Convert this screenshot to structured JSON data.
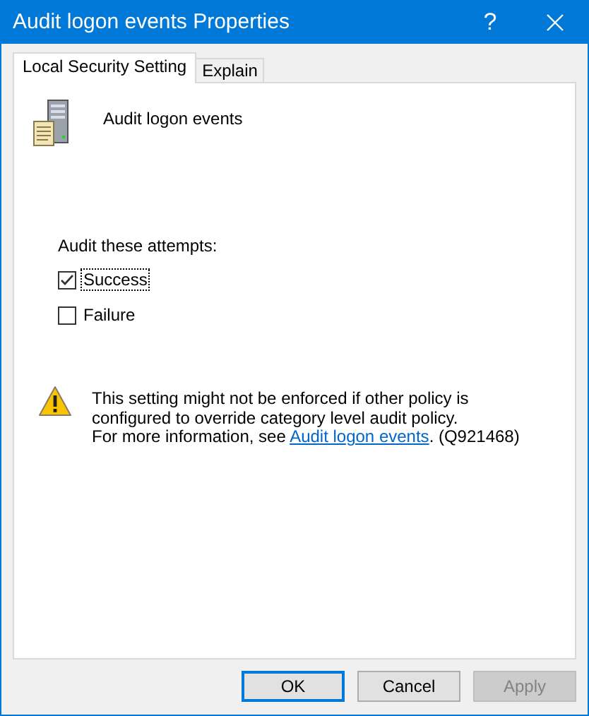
{
  "window": {
    "title": "Audit logon events Properties",
    "help_button": "?"
  },
  "tabs": [
    {
      "label": "Local Security Setting",
      "selected": true
    },
    {
      "label": "Explain",
      "selected": false
    }
  ],
  "policy_name": "Audit logon events",
  "attempts_label": "Audit these attempts:",
  "options": [
    {
      "label": "Success",
      "checked": true,
      "focused": true
    },
    {
      "label": "Failure",
      "checked": false,
      "focused": false
    }
  ],
  "warning": {
    "text": "This setting might not be enforced if other policy is configured to override category level audit policy.",
    "link_prefix": "For more information, see ",
    "link": "Audit logon events",
    "link_suffix": ". (Q921468)"
  },
  "buttons": [
    {
      "label": "OK",
      "default": true,
      "disabled": false
    },
    {
      "label": "Cancel",
      "default": false,
      "disabled": false
    },
    {
      "label": "Apply",
      "default": false,
      "disabled": true
    }
  ]
}
